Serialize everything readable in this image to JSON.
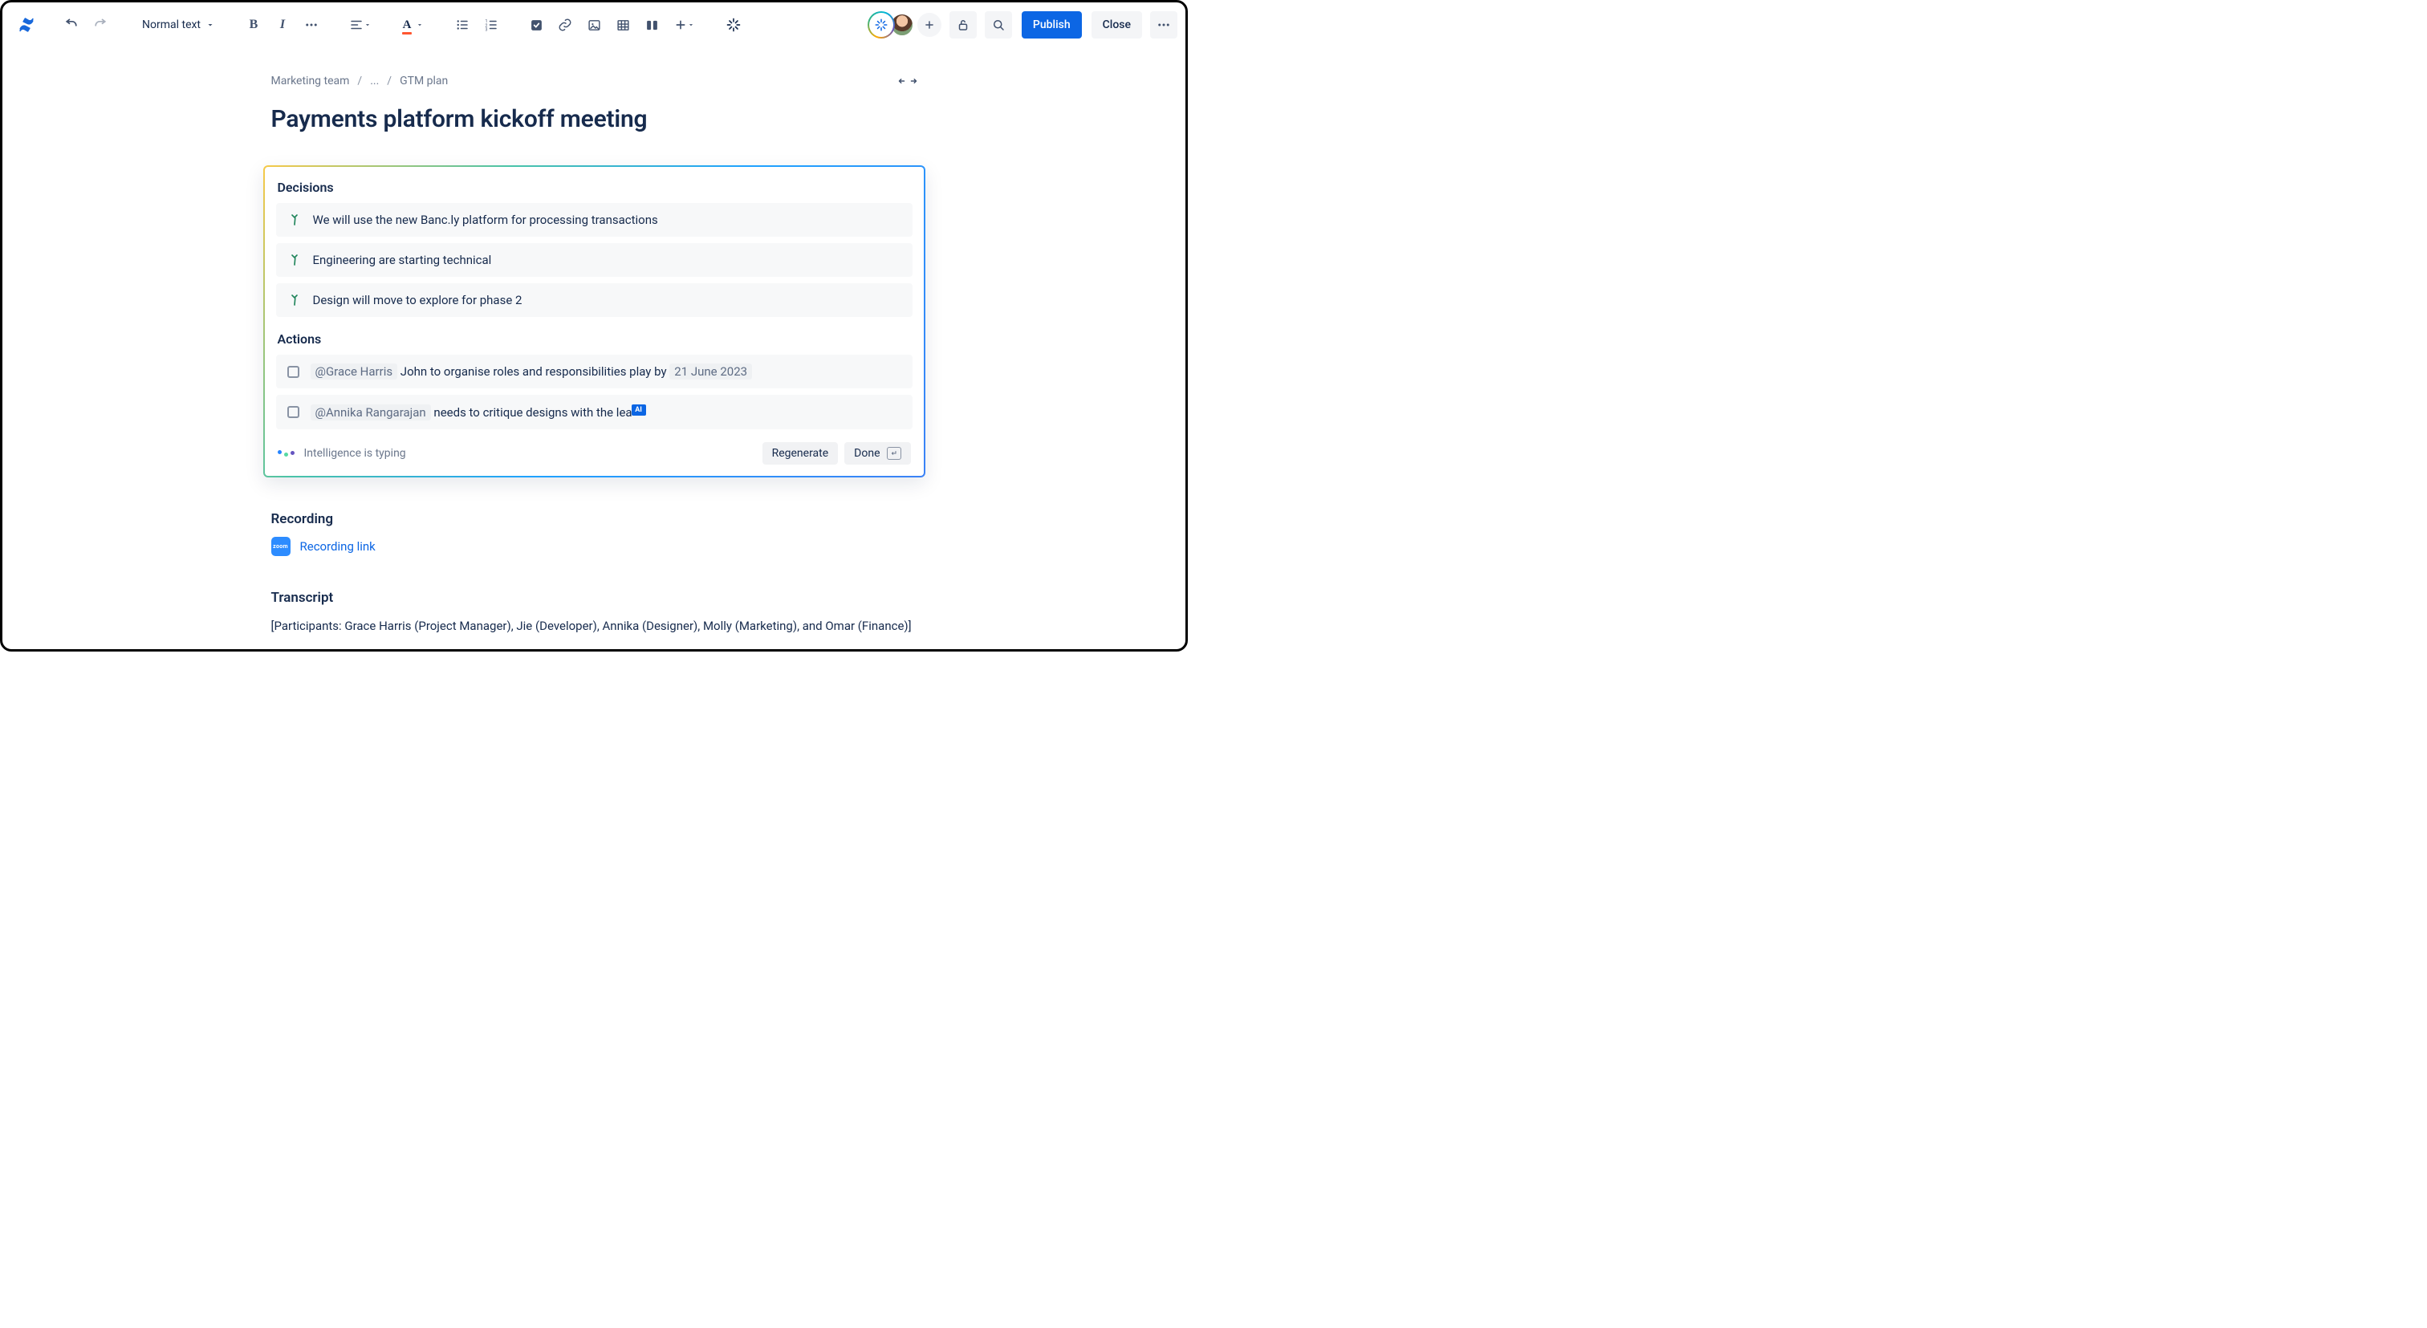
{
  "toolbar": {
    "text_style": "Normal text",
    "publish": "Publish",
    "close": "Close"
  },
  "breadcrumbs": {
    "root": "Marketing team",
    "mid": "...",
    "leaf": "GTM plan"
  },
  "page": {
    "title": "Payments platform kickoff meeting"
  },
  "ai": {
    "decisions_heading": "Decisions",
    "decisions": [
      "We will use the new Banc.ly platform for processing transactions",
      "Engineering are starting technical",
      "Design will move to explore for phase 2"
    ],
    "actions_heading": "Actions",
    "actions": [
      {
        "mention": "@Grace Harris",
        "text": " John to organise roles and responsibilities play by ",
        "date": "21 June 2023"
      },
      {
        "mention": "@Annika Rangarajan",
        "text": " needs to critique designs with the lea",
        "cursor": "AI"
      }
    ],
    "typing_status": "Intelligence is typing",
    "regenerate": "Regenerate",
    "done": "Done"
  },
  "recording": {
    "heading": "Recording",
    "badge": "zoom",
    "link": "Recording link"
  },
  "transcript": {
    "heading": "Transcript",
    "body": "[Participants: Grace Harris (Project Manager), Jie (Developer),  Annika (Designer), Molly (Marketing), and  Omar (Finance)]"
  }
}
